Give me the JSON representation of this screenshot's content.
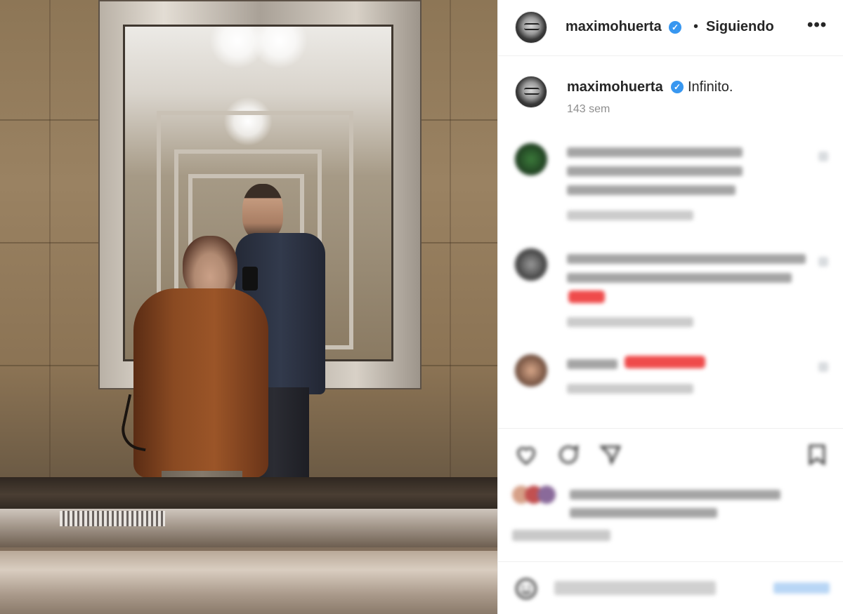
{
  "post": {
    "photo_alt": "",
    "author": {
      "username": "maximohuerta",
      "verified_icon": "verified-badge-icon",
      "follow_separator": "•",
      "follow_status": "Siguiendo",
      "more_icon": "more-options-icon",
      "more_label": "•••"
    },
    "caption": {
      "username": "maximohuerta",
      "text": "Infinito.",
      "time": "143 sem"
    }
  },
  "icons": {
    "like": "heart-icon",
    "comment": "comment-icon",
    "share": "share-icon",
    "save": "bookmark-icon",
    "emoji": "emoji-icon"
  },
  "colors": {
    "verified": "#3897f0",
    "text": "#262626",
    "muted": "#8e8e8e",
    "border": "#efefef"
  }
}
